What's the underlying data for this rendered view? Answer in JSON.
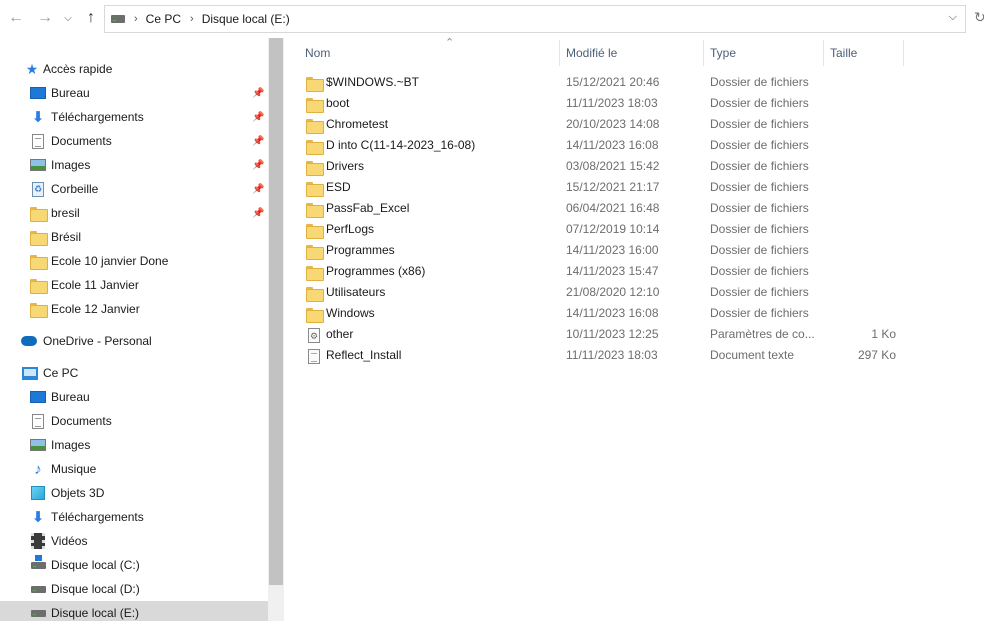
{
  "nav": {
    "back_icon": "arrow-left-icon",
    "forward_icon": "arrow-right-icon",
    "recent_icon": "chevron-down-icon",
    "up_icon": "arrow-up-icon",
    "refresh_icon": "refresh-icon"
  },
  "address": {
    "segments": [
      "Ce PC",
      "Disque local (E:)"
    ]
  },
  "sidebar": {
    "quick_access": {
      "label": "Accès rapide",
      "items": [
        {
          "label": "Bureau",
          "icon": "desktop-icon",
          "pinned": true
        },
        {
          "label": "Téléchargements",
          "icon": "download-icon",
          "pinned": true
        },
        {
          "label": "Documents",
          "icon": "documents-icon",
          "pinned": true
        },
        {
          "label": "Images",
          "icon": "images-icon",
          "pinned": true
        },
        {
          "label": "Corbeille",
          "icon": "recycle-bin-icon",
          "pinned": true
        },
        {
          "label": "bresil",
          "icon": "folder-icon",
          "pinned": true
        },
        {
          "label": "Brésil",
          "icon": "folder-icon",
          "pinned": false
        },
        {
          "label": "Ecole 10 janvier Done",
          "icon": "folder-icon",
          "pinned": false
        },
        {
          "label": "Ecole 11 Janvier",
          "icon": "folder-icon",
          "pinned": false
        },
        {
          "label": "Ecole 12 Janvier",
          "icon": "folder-icon",
          "pinned": false
        }
      ]
    },
    "onedrive": {
      "label": "OneDrive - Personal"
    },
    "this_pc": {
      "label": "Ce PC",
      "items": [
        {
          "label": "Bureau",
          "icon": "desktop-icon"
        },
        {
          "label": "Documents",
          "icon": "documents-icon"
        },
        {
          "label": "Images",
          "icon": "images-icon"
        },
        {
          "label": "Musique",
          "icon": "music-icon"
        },
        {
          "label": "Objets 3D",
          "icon": "objects-3d-icon"
        },
        {
          "label": "Téléchargements",
          "icon": "download-icon"
        },
        {
          "label": "Vidéos",
          "icon": "videos-icon"
        },
        {
          "label": "Disque local (C:)",
          "icon": "drive-c-icon"
        },
        {
          "label": "Disque local (D:)",
          "icon": "drive-icon"
        },
        {
          "label": "Disque local (E:)",
          "icon": "drive-icon",
          "selected": true
        }
      ]
    }
  },
  "columns": {
    "name": "Nom",
    "modified": "Modifié le",
    "type": "Type",
    "size": "Taille"
  },
  "files": [
    {
      "name": "$WINDOWS.~BT",
      "modified": "15/12/2021 20:46",
      "type": "Dossier de fichiers",
      "size": "",
      "icon": "folder-icon"
    },
    {
      "name": "boot",
      "modified": "11/11/2023 18:03",
      "type": "Dossier de fichiers",
      "size": "",
      "icon": "folder-icon"
    },
    {
      "name": "Chrometest",
      "modified": "20/10/2023 14:08",
      "type": "Dossier de fichiers",
      "size": "",
      "icon": "folder-icon"
    },
    {
      "name": "D into C(11-14-2023_16-08)",
      "modified": "14/11/2023 16:08",
      "type": "Dossier de fichiers",
      "size": "",
      "icon": "folder-icon"
    },
    {
      "name": "Drivers",
      "modified": "03/08/2021 15:42",
      "type": "Dossier de fichiers",
      "size": "",
      "icon": "folder-icon"
    },
    {
      "name": "ESD",
      "modified": "15/12/2021 21:17",
      "type": "Dossier de fichiers",
      "size": "",
      "icon": "folder-icon"
    },
    {
      "name": "PassFab_Excel",
      "modified": "06/04/2021 16:48",
      "type": "Dossier de fichiers",
      "size": "",
      "icon": "folder-icon"
    },
    {
      "name": "PerfLogs",
      "modified": "07/12/2019 10:14",
      "type": "Dossier de fichiers",
      "size": "",
      "icon": "folder-icon"
    },
    {
      "name": "Programmes",
      "modified": "14/11/2023 16:00",
      "type": "Dossier de fichiers",
      "size": "",
      "icon": "folder-icon"
    },
    {
      "name": "Programmes (x86)",
      "modified": "14/11/2023 15:47",
      "type": "Dossier de fichiers",
      "size": "",
      "icon": "folder-icon"
    },
    {
      "name": "Utilisateurs",
      "modified": "21/08/2020 12:10",
      "type": "Dossier de fichiers",
      "size": "",
      "icon": "folder-icon"
    },
    {
      "name": "Windows",
      "modified": "14/11/2023 16:08",
      "type": "Dossier de fichiers",
      "size": "",
      "icon": "folder-icon"
    },
    {
      "name": "other",
      "modified": "10/11/2023 12:25",
      "type": "Paramètres de co...",
      "size": "1 Ko",
      "icon": "settings-file-icon"
    },
    {
      "name": "Reflect_Install",
      "modified": "11/11/2023 18:03",
      "type": "Document texte",
      "size": "297 Ko",
      "icon": "text-file-icon"
    }
  ]
}
